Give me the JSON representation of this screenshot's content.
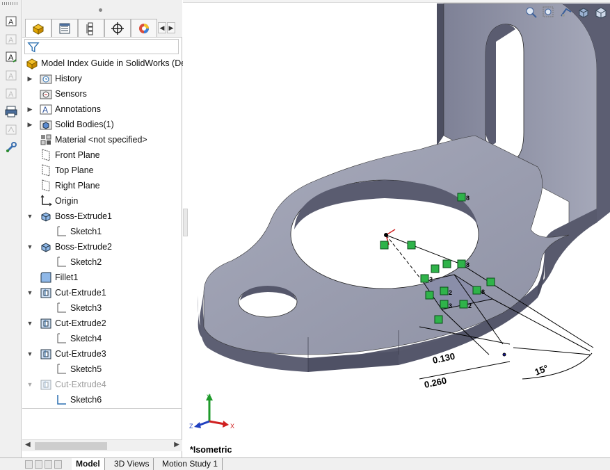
{
  "tree": {
    "root": "Model Index Guide in SolidWorks  (Def",
    "items": [
      {
        "label": "History",
        "icon": "history-folder-icon"
      },
      {
        "label": "Sensors",
        "icon": "sensors-icon"
      },
      {
        "label": "Annotations",
        "icon": "annotations-icon"
      },
      {
        "label": "Solid Bodies(1)",
        "icon": "solid-bodies-icon"
      },
      {
        "label": "Material <not specified>",
        "icon": "material-icon"
      },
      {
        "label": "Front Plane",
        "icon": "plane-icon"
      },
      {
        "label": "Top Plane",
        "icon": "plane-icon"
      },
      {
        "label": "Right Plane",
        "icon": "plane-icon"
      },
      {
        "label": "Origin",
        "icon": "origin-icon"
      },
      {
        "label": "Boss-Extrude1",
        "icon": "boss-extrude-icon"
      },
      {
        "label": "Sketch1",
        "icon": "sketch-icon"
      },
      {
        "label": "Boss-Extrude2",
        "icon": "boss-extrude-icon"
      },
      {
        "label": "Sketch2",
        "icon": "sketch-icon"
      },
      {
        "label": "Fillet1",
        "icon": "fillet-icon"
      },
      {
        "label": "Cut-Extrude1",
        "icon": "cut-extrude-icon"
      },
      {
        "label": "Sketch3",
        "icon": "sketch-icon"
      },
      {
        "label": "Cut-Extrude2",
        "icon": "cut-extrude-icon"
      },
      {
        "label": "Sketch4",
        "icon": "sketch-icon"
      },
      {
        "label": "Cut-Extrude3",
        "icon": "cut-extrude-icon"
      },
      {
        "label": "Sketch5",
        "icon": "sketch-icon"
      },
      {
        "label": "Cut-Extrude4",
        "icon": "cut-extrude-icon",
        "state": "suppressed"
      },
      {
        "label": "Sketch6",
        "icon": "sketch-icon",
        "state": "active-sketch"
      }
    ]
  },
  "bottom_tabs": [
    "Model",
    "3D Views",
    "Motion Study 1"
  ],
  "active_bottom_tab": "Model",
  "viewport": {
    "view_label": "*Isometric",
    "dimensions": {
      "dim_a": "0.130",
      "dim_b": "0.260",
      "angle": "15°"
    },
    "relation_numbers": {
      "r8a": "8",
      "r8b": "8",
      "r3a": "3",
      "r3b": "3",
      "r2a": "2",
      "r2b": "2",
      "r8c": "8"
    },
    "triad": {
      "x": "X",
      "y": "Y",
      "z": "Z"
    }
  },
  "colors": {
    "part_top": "#9a9db0",
    "part_side": "#585a6d",
    "relation_green": "#2fb34a",
    "sketch_line": "#000000"
  }
}
